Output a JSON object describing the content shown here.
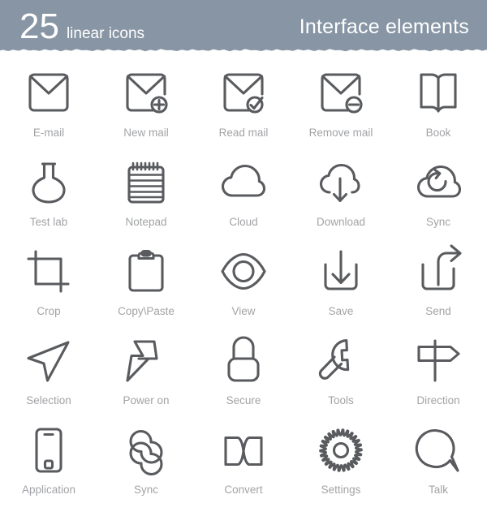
{
  "header": {
    "count": "25",
    "subtitle": "linear icons",
    "right_title": "Interface elements",
    "background_color": "#8795a5",
    "text_color": "#ffffff"
  },
  "theme": {
    "page_background": "#ffffff",
    "icon_stroke_color": "#595b5e",
    "label_color": "#a2a3a6"
  },
  "grid": {
    "columns": 5,
    "rows": 5,
    "total_icons": 25,
    "items": [
      {
        "label": "E-mail",
        "icon": "envelope-icon"
      },
      {
        "label": "New mail",
        "icon": "envelope-plus-icon"
      },
      {
        "label": "Read mail",
        "icon": "envelope-check-icon"
      },
      {
        "label": "Remove mail",
        "icon": "envelope-minus-icon"
      },
      {
        "label": "Book",
        "icon": "open-book-icon"
      },
      {
        "label": "Test lab",
        "icon": "flask-icon"
      },
      {
        "label": "Notepad",
        "icon": "spiral-notepad-icon"
      },
      {
        "label": "Cloud",
        "icon": "cloud-icon"
      },
      {
        "label": "Download",
        "icon": "cloud-download-icon"
      },
      {
        "label": "Sync",
        "icon": "cloud-refresh-icon"
      },
      {
        "label": "Crop",
        "icon": "crop-icon"
      },
      {
        "label": "Copy\\Paste",
        "icon": "clipboard-icon"
      },
      {
        "label": "View",
        "icon": "eye-icon"
      },
      {
        "label": "Save",
        "icon": "tray-download-icon"
      },
      {
        "label": "Send",
        "icon": "tray-share-icon"
      },
      {
        "label": "Selection",
        "icon": "cursor-arrow-icon"
      },
      {
        "label": "Power on",
        "icon": "lightning-bolt-icon"
      },
      {
        "label": "Secure",
        "icon": "padlock-icon"
      },
      {
        "label": "Tools",
        "icon": "wrench-icon"
      },
      {
        "label": "Direction",
        "icon": "signpost-icon"
      },
      {
        "label": "Application",
        "icon": "smartphone-icon"
      },
      {
        "label": "Sync",
        "icon": "infinity-loop-icon"
      },
      {
        "label": "Convert",
        "icon": "bowtie-convert-icon"
      },
      {
        "label": "Settings",
        "icon": "gear-icon"
      },
      {
        "label": "Talk",
        "icon": "speech-bubble-icon"
      }
    ]
  }
}
